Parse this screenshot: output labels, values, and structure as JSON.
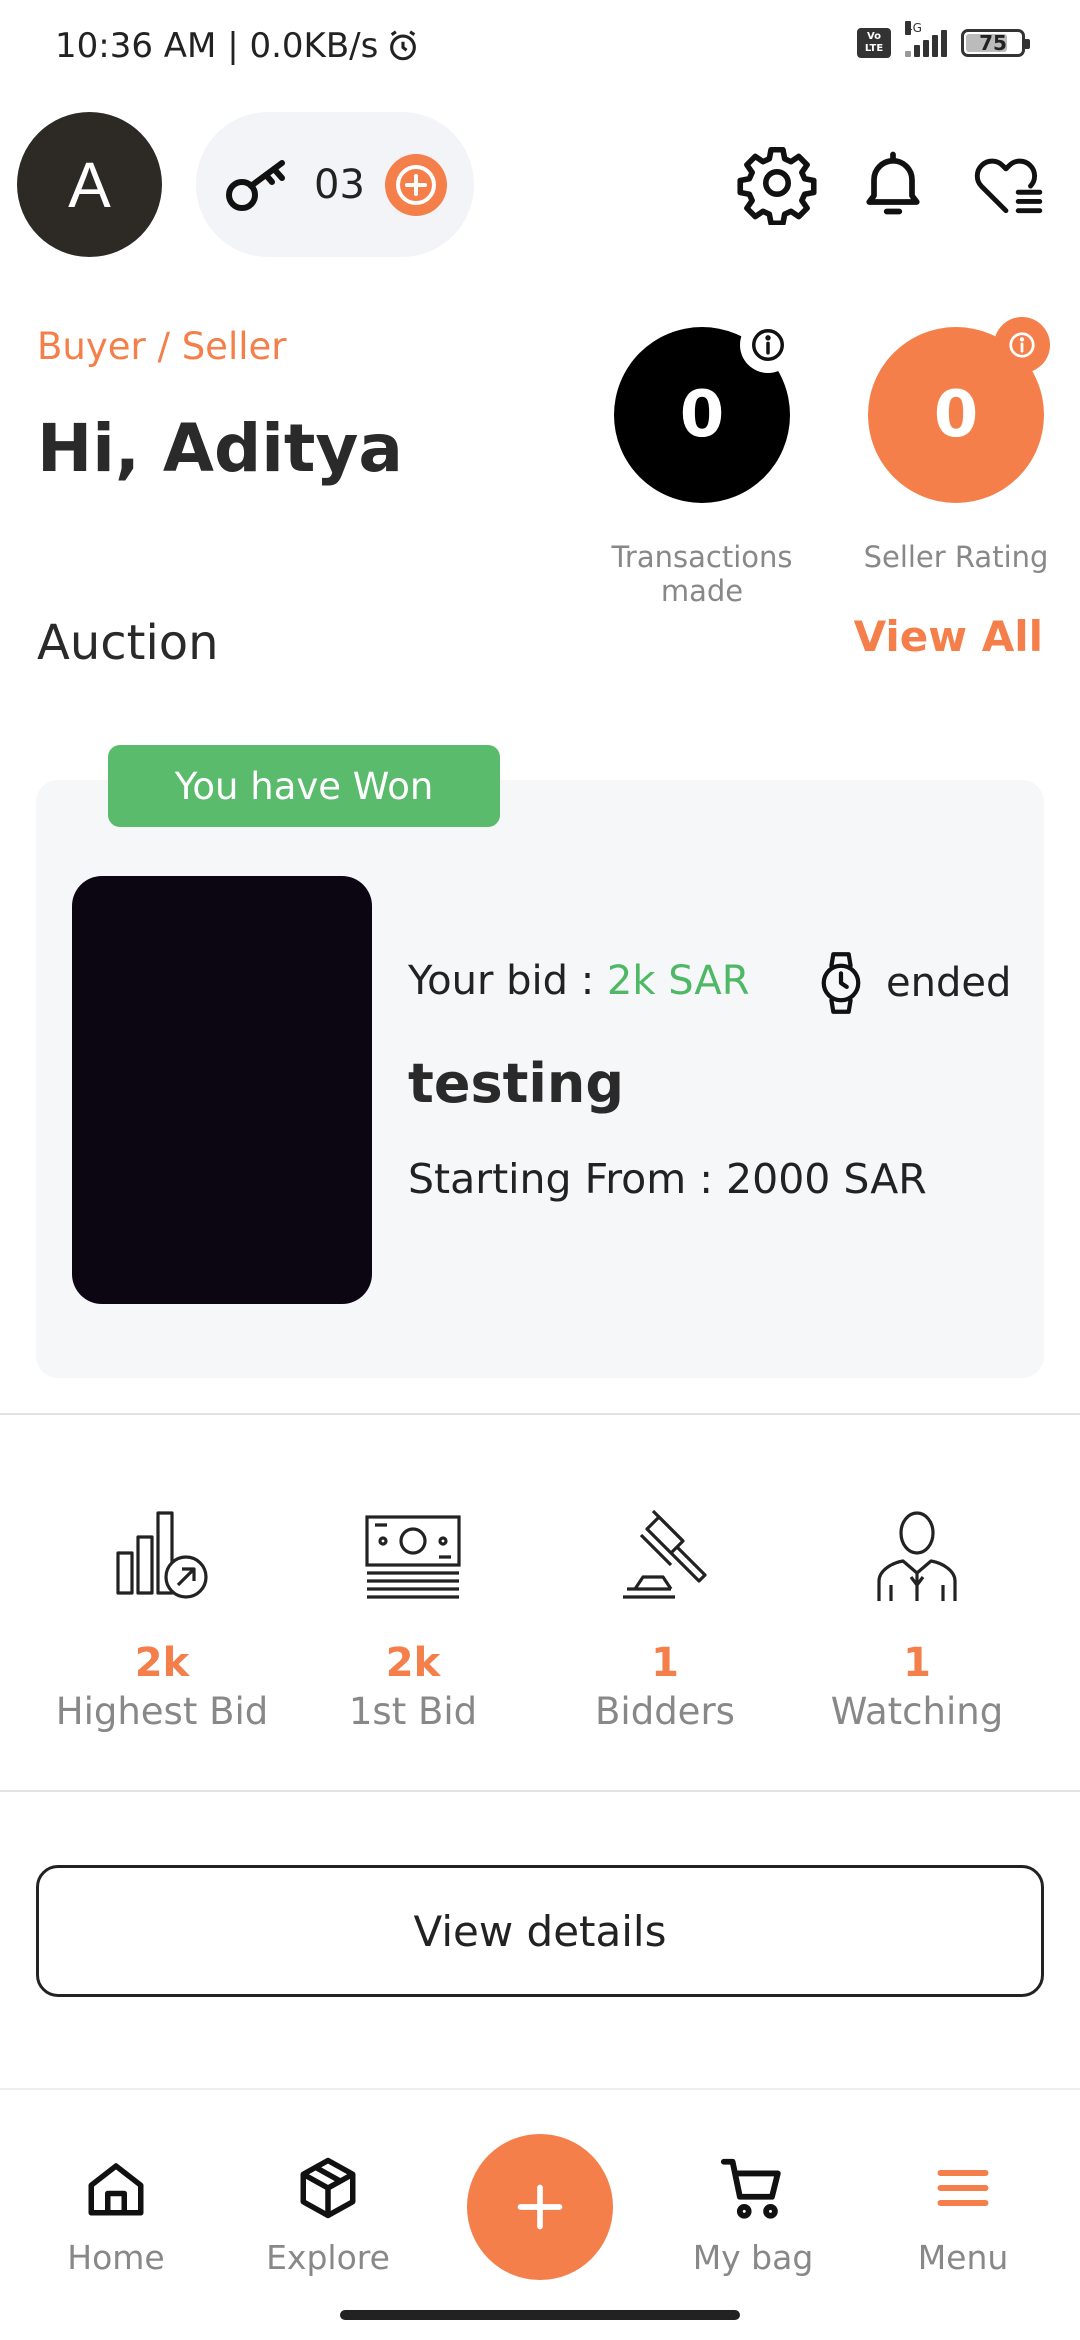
{
  "status_bar": {
    "time": "10:36 AM | 0.0KB/s",
    "volte": "Vo LTE",
    "network": "4G",
    "battery": "75",
    "battery_level": 0.75
  },
  "header": {
    "avatar_letter": "A",
    "keys_count": "03"
  },
  "profile": {
    "role": "Buyer / Seller",
    "greeting": "Hi, Aditya",
    "transactions_value": "0",
    "transactions_label": "Transactions made",
    "rating_value": "0",
    "rating_label": "Seller Rating"
  },
  "auction_section": {
    "title": "Auction",
    "view_all": "View All"
  },
  "auction_card": {
    "badge": "You have Won",
    "bid_prefix": "Your bid : ",
    "bid_value": "2k SAR",
    "status": "ended",
    "item_title": "testing",
    "starting_from": "Starting From : 2000 SAR"
  },
  "stats": [
    {
      "value": "2k",
      "label": "Highest Bid",
      "icon": "bar-chart-icon"
    },
    {
      "value": "2k",
      "label": "1st Bid",
      "icon": "money-icon"
    },
    {
      "value": "1",
      "label": "Bidders",
      "icon": "gavel-icon"
    },
    {
      "value": "1",
      "label": "Watching",
      "icon": "person-icon"
    }
  ],
  "view_details": "View details",
  "bottom_nav": {
    "home": "Home",
    "explore": "Explore",
    "bag": "My bag",
    "menu": "Menu"
  },
  "colors": {
    "accent": "#f47f4a",
    "success": "#5abb6c"
  }
}
